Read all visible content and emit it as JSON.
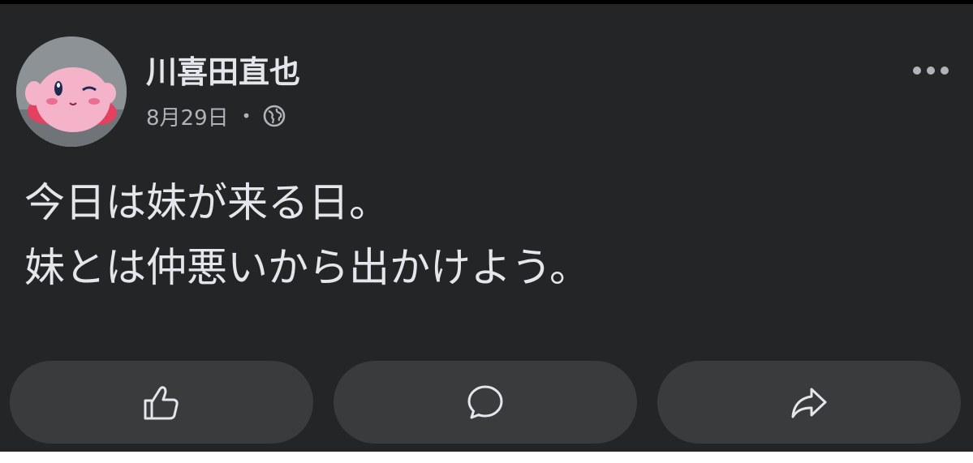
{
  "post": {
    "author": {
      "name": "川喜田直也",
      "avatar_icon": "plush-avatar"
    },
    "date": "8月29日",
    "separator": "•",
    "privacy_icon": "globe-icon",
    "more_icon": "more-horizontal-icon",
    "body_lines": [
      "今日は妹が来る日。",
      "妹とは仲悪いから出かけよう。"
    ],
    "actions": [
      {
        "id": "like",
        "icon": "thumbs-up-icon"
      },
      {
        "id": "comment",
        "icon": "comment-icon"
      },
      {
        "id": "share",
        "icon": "share-icon"
      }
    ]
  },
  "theme": {
    "card_background": "#242526",
    "button_background": "#3a3b3c",
    "primary_text": "#e4e6eb",
    "secondary_text": "#b0b3b8",
    "top_bar": "#000000"
  }
}
